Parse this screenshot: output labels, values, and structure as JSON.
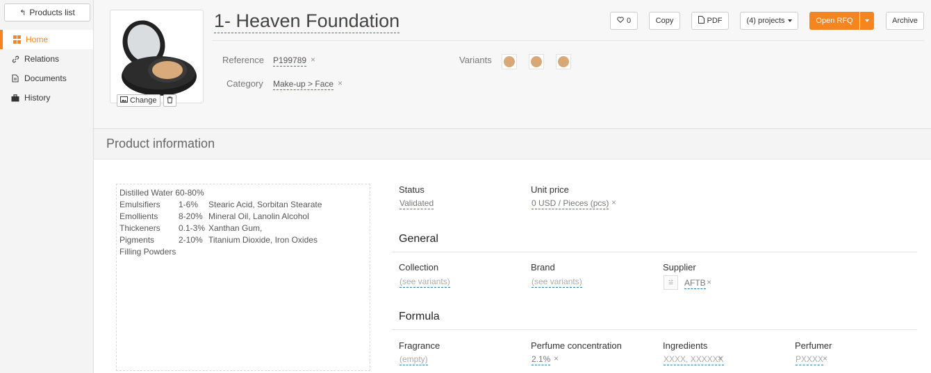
{
  "sidebar": {
    "back_label": "Products list",
    "collapse_label": "<",
    "items": [
      {
        "label": "Home",
        "icon": "grid-icon",
        "active": true
      },
      {
        "label": "Relations",
        "icon": "link-icon"
      },
      {
        "label": "Documents",
        "icon": "document-icon"
      },
      {
        "label": "History",
        "icon": "briefcase-icon"
      }
    ]
  },
  "product": {
    "title": "1- Heaven Foundation",
    "image_actions": {
      "change_label": "Change"
    },
    "reference_label": "Reference",
    "reference_value": "P199789",
    "category_label": "Category",
    "category_value": "Make-up > Face",
    "variants_label": "Variants",
    "variant_color": "#d8a878"
  },
  "toolbar": {
    "likes": "0",
    "copy_label": "Copy",
    "pdf_label": "PDF",
    "projects_label": "(4) projects",
    "open_rfq_label": "Open RFQ",
    "archive_label": "Archive"
  },
  "section": {
    "title": "Product information"
  },
  "composition": [
    {
      "name": "Distilled Water",
      "percent": "60-80%",
      "items": ""
    },
    {
      "name": "Emulsifiers",
      "percent": "1-6%",
      "items": "Stearic Acid, Sorbitan Stearate"
    },
    {
      "name": "Emollients",
      "percent": "8-20%",
      "items": "Mineral Oil, Lanolin Alcohol"
    },
    {
      "name": "Thickeners",
      "percent": "0.1-3%",
      "items": "Xanthan Gum,"
    },
    {
      "name": "Pigments",
      "percent": "2-10%",
      "items": "Titanium Dioxide, Iron Oxides"
    },
    {
      "name": "Filling Powders",
      "percent": "",
      "items": ""
    }
  ],
  "fields": {
    "status_label": "Status",
    "status_value": "Validated",
    "unit_price_label": "Unit price",
    "unit_price_value": "0 USD / Pieces (pcs)",
    "general_title": "General",
    "collection_label": "Collection",
    "collection_value": "(see variants)",
    "brand_label": "Brand",
    "brand_value": "(see variants)",
    "supplier_label": "Supplier",
    "supplier_value": "AFTB",
    "formula_title": "Formula",
    "fragrance_label": "Fragrance",
    "fragrance_value": "(empty)",
    "perfume_conc_label": "Perfume concentration",
    "perfume_conc_value": "2.1%",
    "ingredients_label": "Ingredients",
    "ingredients_value": "XXXX, XXXXXX",
    "perfumer_label": "Perfumer",
    "perfumer_value": "PXXXX"
  },
  "colors": {
    "accent": "#f6841f",
    "link_underline": "#2a7ab0"
  }
}
